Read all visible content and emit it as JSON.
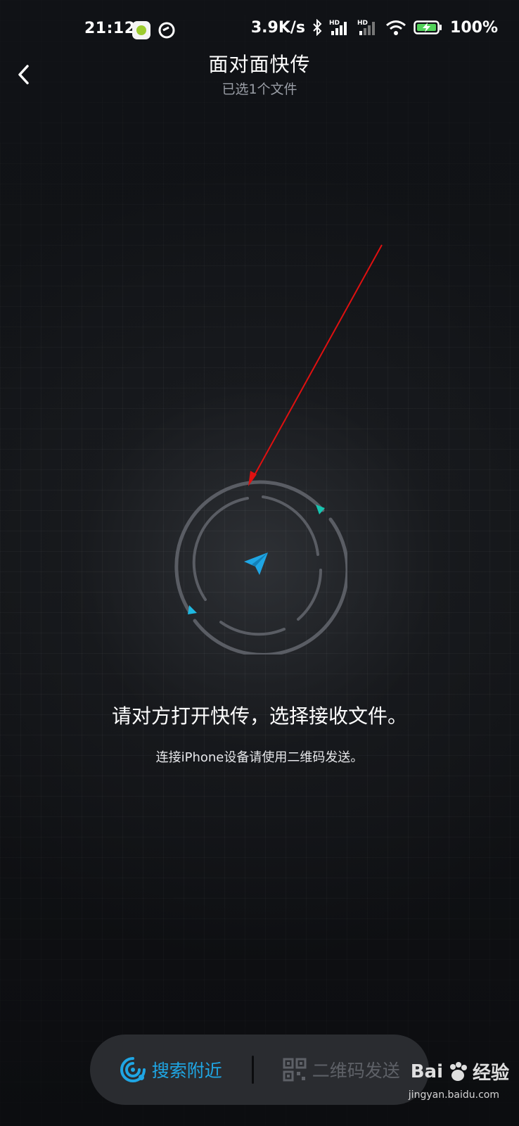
{
  "status_bar": {
    "time": "21:12",
    "network_speed": "3.9K/s",
    "hd_1": "HD",
    "hd_2": "HD",
    "battery_percent": "100%",
    "icons": [
      "app-icon",
      "qr-scan-icon",
      "bluetooth-icon",
      "signal-icon",
      "signal-icon",
      "wifi-icon",
      "battery-charging-icon"
    ]
  },
  "header": {
    "title": "面对面快传",
    "subtitle": "已选1个文件",
    "back_icon": "chevron-left-icon"
  },
  "radar": {
    "center_icon": "paper-plane-icon",
    "accent_color": "#1fa6e4",
    "teal_color": "#17c4b0"
  },
  "instructions": {
    "main": "请对方打开快传，选择接收文件。",
    "sub": "连接iPhone设备请使用二维码发送。"
  },
  "bottom_bar": {
    "search_label": "搜索附近",
    "search_icon": "nearby-search-icon",
    "qr_label": "二维码发送",
    "qr_icon": "qr-code-icon",
    "active_color": "#1fa6e4",
    "inactive_color": "#5e6167"
  },
  "watermark": {
    "brand": "Bai",
    "brand_suffix": "经验",
    "url": "jingyan.baidu.com"
  }
}
